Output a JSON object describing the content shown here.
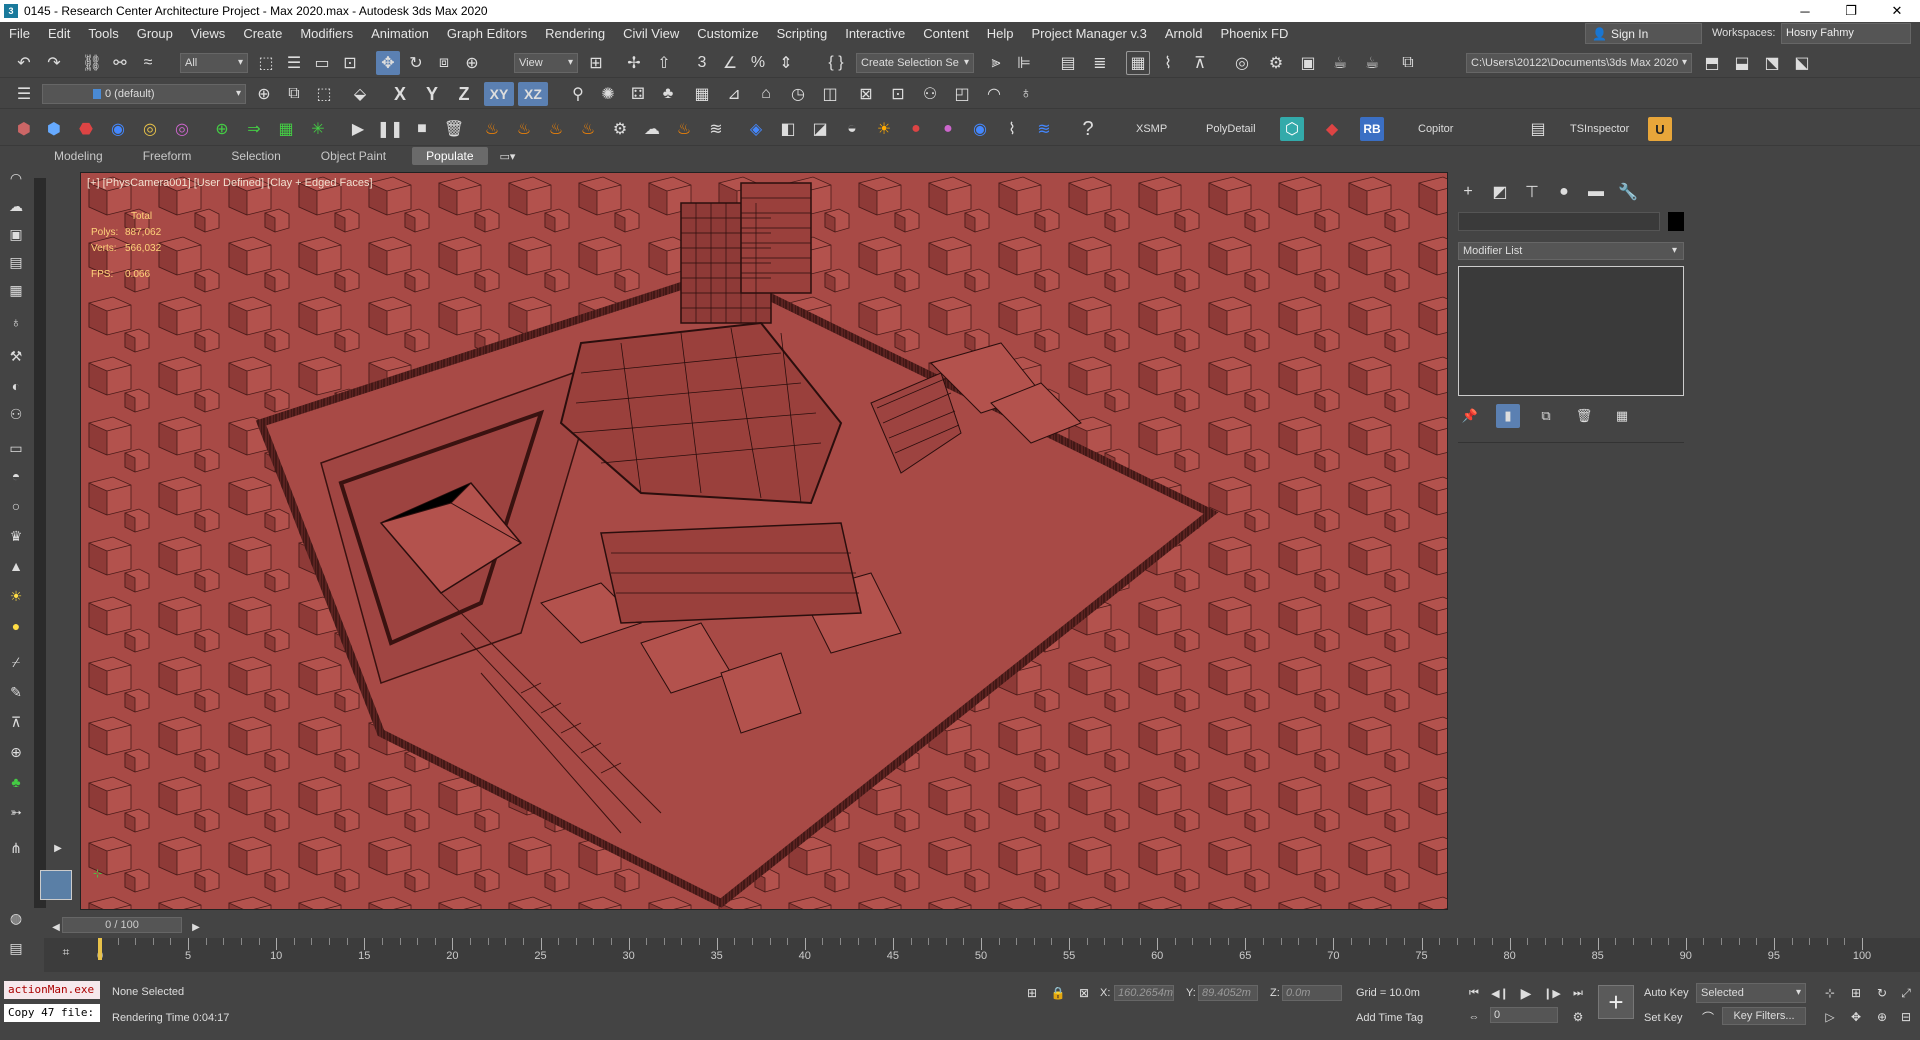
{
  "window": {
    "title": "0145 - Research Center Architecture Project - Max 2020.max - Autodesk 3ds Max 2020",
    "app_icon": "3"
  },
  "menus": [
    "File",
    "Edit",
    "Tools",
    "Group",
    "Views",
    "Create",
    "Modifiers",
    "Animation",
    "Graph Editors",
    "Rendering",
    "Civil View",
    "Customize",
    "Scripting",
    "Interactive",
    "Content",
    "Help",
    "Project Manager v.3",
    "Arnold",
    "Phoenix FD"
  ],
  "account": {
    "sign_in": "Sign In",
    "workspaces_label": "Workspaces:",
    "workspace": "Hosny Fahmy"
  },
  "toolbar1": {
    "selection_filter": "All",
    "ref_coord": "View",
    "named_selection": "Create Selection Se",
    "project_path": "C:\\Users\\20122\\Documents\\3ds Max 2020"
  },
  "toolbar2": {
    "layer": "0 (default)",
    "axis_x": "X",
    "axis_y": "Y",
    "axis_z": "Z",
    "axis_xy": "XY",
    "axis_xz": "XZ"
  },
  "toolbar3": {
    "xsmp": "XSMP",
    "polydetail": "PolyDetail",
    "rb": "RB",
    "copitor": "Copitor",
    "tsinspector": "TSInspector"
  },
  "ribbon_tabs": [
    "Modeling",
    "Freeform",
    "Selection",
    "Object Paint",
    "Populate"
  ],
  "ribbon_active": "Populate",
  "viewport": {
    "label": "[+] [PhysCamera001] [User Defined] [Clay + Edged Faces]",
    "stats": {
      "total_label": "Total",
      "polys_label": "Polys:",
      "polys": "887,062",
      "verts_label": "Verts:",
      "verts": "566,032",
      "fps_label": "FPS:",
      "fps": "0.066"
    }
  },
  "command_panel": {
    "modifier_list": "Modifier List"
  },
  "timeline": {
    "frame": "0 / 100",
    "ticks": [
      "0",
      "5",
      "10",
      "15",
      "20",
      "25",
      "30",
      "35",
      "40",
      "45",
      "50",
      "55",
      "60",
      "65",
      "70",
      "75",
      "80",
      "85",
      "90",
      "95",
      "100"
    ]
  },
  "status": {
    "listener1": "actionMan.exe",
    "listener2": "Copy 47 file:",
    "selection": "None Selected",
    "render_time": "Rendering Time  0:04:17",
    "x_label": "X:",
    "x_value": "160.2654m",
    "y_label": "Y:",
    "y_value": "89.4052m",
    "z_label": "Z:",
    "z_value": "0.0m",
    "grid": "Grid = 10.0m",
    "add_time_tag": "Add Time Tag",
    "auto_key": "Auto Key",
    "set_key": "Set Key",
    "selected": "Selected",
    "key_filters": "Key Filters...",
    "frame_value": "0"
  },
  "colors": {
    "viewport_clay": "#a84a46",
    "ui_dark": "#444444",
    "accent": "#5b80b2",
    "stats": "#ffd27a"
  }
}
